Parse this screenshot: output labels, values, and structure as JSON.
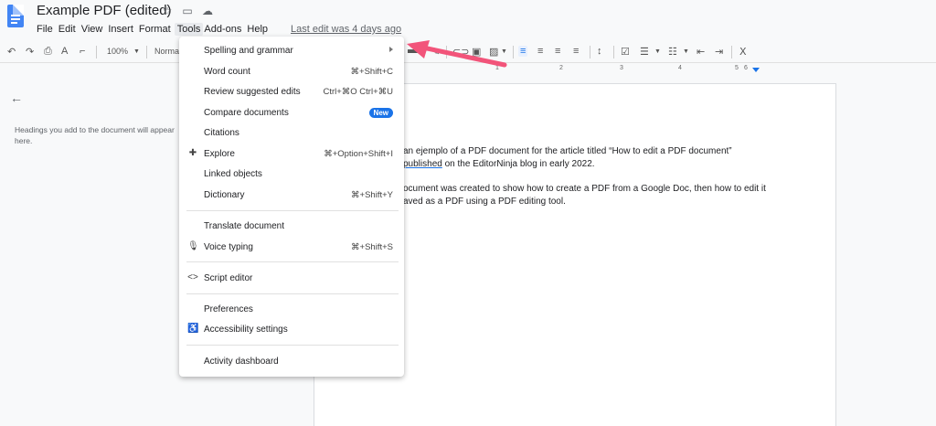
{
  "header": {
    "title": "Example PDF (edited)",
    "last_edit": "Last edit was 4 days ago",
    "menu": [
      "File",
      "Edit",
      "View",
      "Insert",
      "Format",
      "Tools",
      "Add-ons",
      "Help"
    ]
  },
  "toolbar": {
    "zoom": "100%",
    "style": "Normal"
  },
  "ruler": [
    "1",
    "2",
    "3",
    "4",
    "5",
    "6"
  ],
  "outline": {
    "hint": "Headings you add to the document will appear here."
  },
  "document": {
    "p1_line1": "an ejemplo of a PDF document for the article titled “How to edit a PDF document”",
    "p1_line2_link": "published",
    "p1_line2_rest": " on the EditorNinja blog in early 2022.",
    "p2_line1": "ocument was created to show how to create a PDF from a Google Doc, then how to edit it",
    "p2_line2": "aved as a PDF using a PDF editing tool."
  },
  "tools_menu": {
    "spelling": "Spelling and grammar",
    "word_count": "Word count",
    "word_count_sc": "⌘+Shift+C",
    "review_edits": "Review suggested edits",
    "review_edits_sc": "Ctrl+⌘O Ctrl+⌘U",
    "compare": "Compare documents",
    "compare_badge": "New",
    "citations": "Citations",
    "explore": "Explore",
    "explore_sc": "⌘+Option+Shift+I",
    "linked_objects": "Linked objects",
    "dictionary": "Dictionary",
    "dictionary_sc": "⌘+Shift+Y",
    "translate": "Translate document",
    "voice_typing": "Voice typing",
    "voice_typing_sc": "⌘+Shift+S",
    "script_editor": "Script editor",
    "preferences": "Preferences",
    "accessibility": "Accessibility settings",
    "activity": "Activity dashboard"
  },
  "colors": {
    "accent": "#1a73e8",
    "annotation_arrow": "#f2547a"
  }
}
